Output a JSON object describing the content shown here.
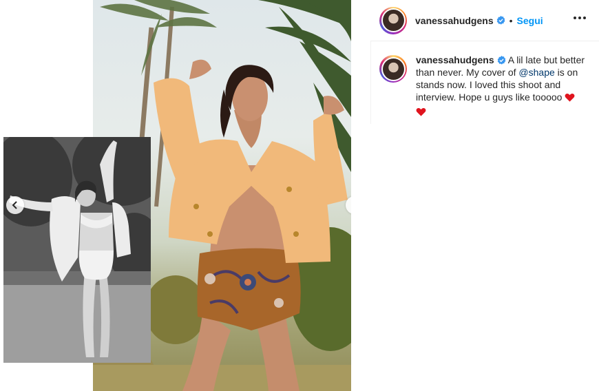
{
  "post": {
    "username": "vanessahudgens",
    "follow_label": "Segui",
    "separator": "•",
    "caption": {
      "username": "vanessahudgens",
      "text_before_mention": "A lil late but better than never. My cover of ",
      "mention": "@shape",
      "text_after_mention": " is on stands now. I loved this shoot and interview. Hope u guys like tooooo "
    }
  },
  "icons": {
    "verified": "verified-badge-icon",
    "more": "more-options-icon",
    "prev": "chevron-left-icon",
    "next": "chevron-right-icon",
    "heart": "red-heart-emoji"
  },
  "colors": {
    "follow": "#0095f6",
    "mention": "#00376b",
    "verified": "#3897f0",
    "heart": "#e0141e"
  }
}
